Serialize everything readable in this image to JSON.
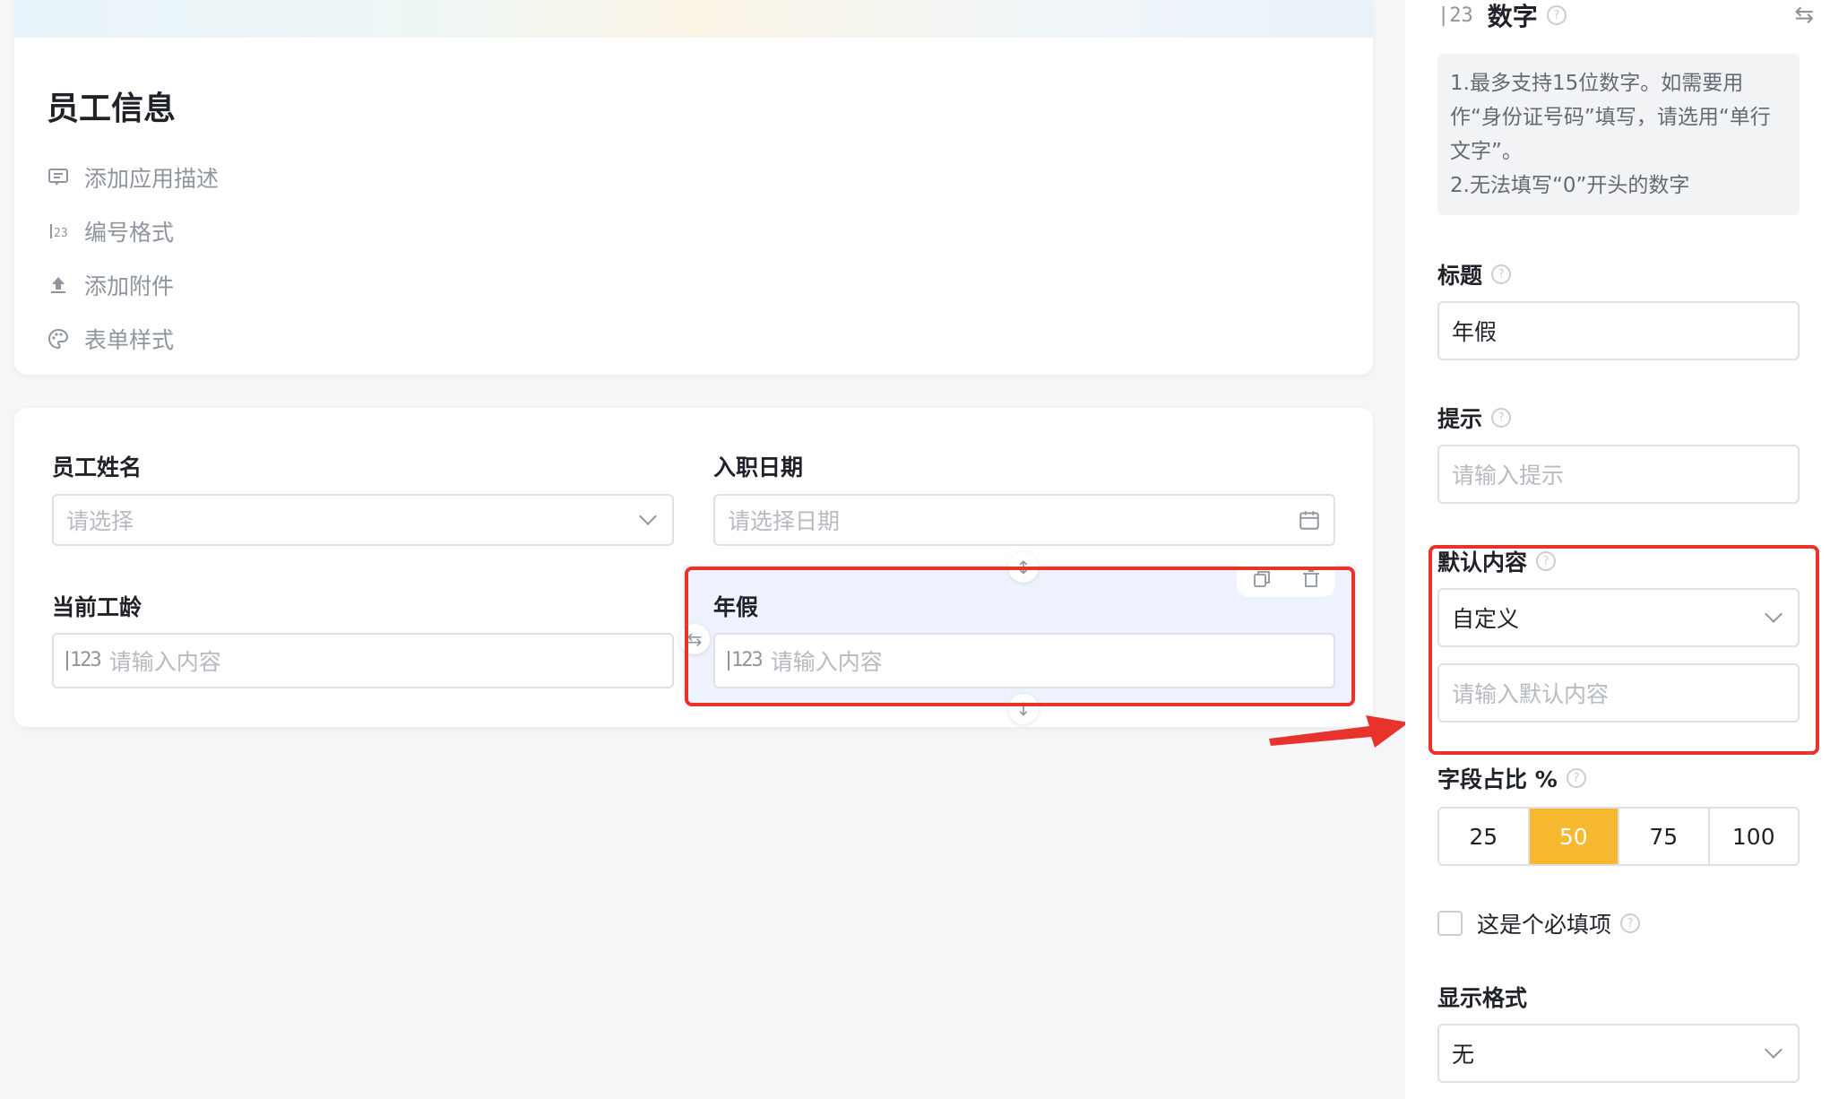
{
  "app": {
    "title": "员工信息",
    "meta_items": [
      {
        "icon": "comment-icon",
        "label": "添加应用描述"
      },
      {
        "icon": "number-format-icon",
        "label": "编号格式"
      },
      {
        "icon": "upload-icon",
        "label": "添加附件"
      },
      {
        "icon": "palette-icon",
        "label": "表单样式"
      }
    ]
  },
  "form": {
    "fields": [
      {
        "label": "员工姓名",
        "placeholder": "请选择",
        "type": "select"
      },
      {
        "label": "入职日期",
        "placeholder": "请选择日期",
        "type": "date"
      },
      {
        "label": "当前工龄",
        "placeholder": "请输入内容",
        "type": "number"
      },
      {
        "label": "年假",
        "placeholder": "请输入内容",
        "type": "number",
        "selected": true
      }
    ],
    "number_icon_glyph": "123"
  },
  "panel": {
    "field_type": "数字",
    "field_type_icon": "number-icon",
    "tips": [
      "1.最多支持15位数字。如需要用作“身份证号码”填写，请选用“单行文字”。",
      "2.无法填写“0”开头的数字"
    ],
    "title_label": "标题",
    "title_value": "年假",
    "hint_label": "提示",
    "hint_placeholder": "请输入提示",
    "default_label": "默认内容",
    "default_mode": "自定义",
    "default_placeholder": "请输入默认内容",
    "width_label": "字段占比 %",
    "width_options": [
      "25",
      "50",
      "75",
      "100"
    ],
    "width_selected": "50",
    "required_label": "这是个必填项",
    "required_checked": false,
    "display_label": "显示格式",
    "display_value": "无"
  },
  "colors": {
    "accent": "#f5b82e",
    "highlight": "#e8322c",
    "selected_bg": "#eef2fd"
  }
}
